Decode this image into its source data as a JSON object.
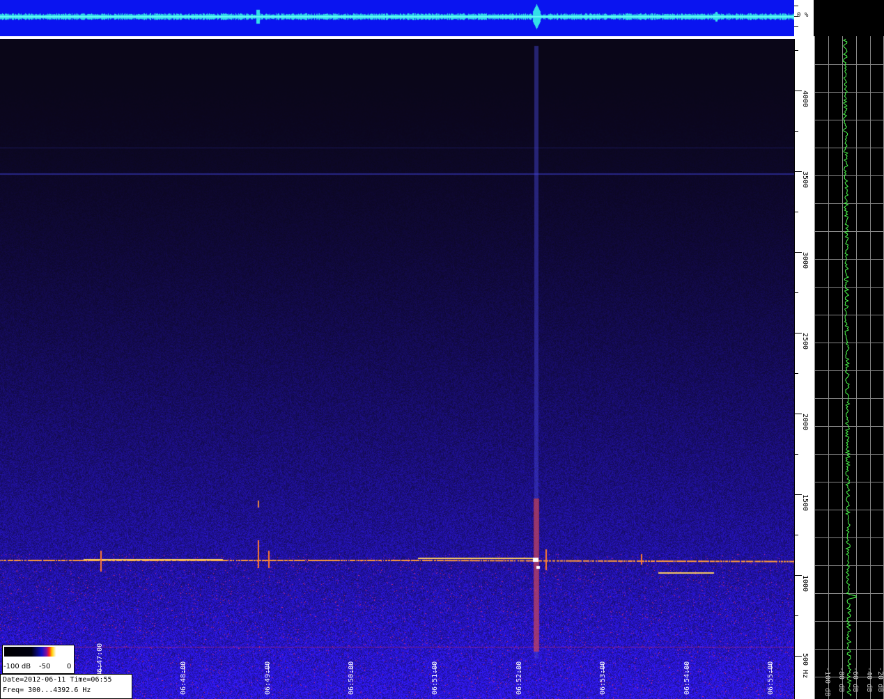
{
  "waveform": {
    "scale_label": "0 %"
  },
  "spectrogram": {
    "freq_axis": {
      "labels": [
        "4000",
        "3500",
        "3000",
        "2500",
        "2000",
        "1500",
        "1000",
        "500 Hz"
      ],
      "min_hz": 300,
      "max_hz": 4392.6
    },
    "time_axis": {
      "labels": [
        "06:47:00",
        "06:48:00",
        "06:49:00",
        "06:50:00",
        "06:51:00",
        "06:52:00",
        "06:53:00",
        "06:54:00",
        "06:55:00"
      ]
    }
  },
  "colorbar": {
    "labels": [
      "-100 dB",
      "-50",
      "0"
    ]
  },
  "info": {
    "date_line": "Date=2012-06-11 Time=06:55",
    "freq_line": "Freq= 300...4392.6 Hz"
  },
  "spectrum": {
    "db_labels": [
      "-100 dB",
      "-80 dB",
      "-60 dB",
      "-40 dB",
      "-20 dB"
    ]
  },
  "colors": {
    "waveform_bg": "#0a14f0",
    "waveform_trace": "#33e0e8",
    "spectrum_trace": "#4dff4d",
    "meteor_echo": "#ff9a3a"
  }
}
